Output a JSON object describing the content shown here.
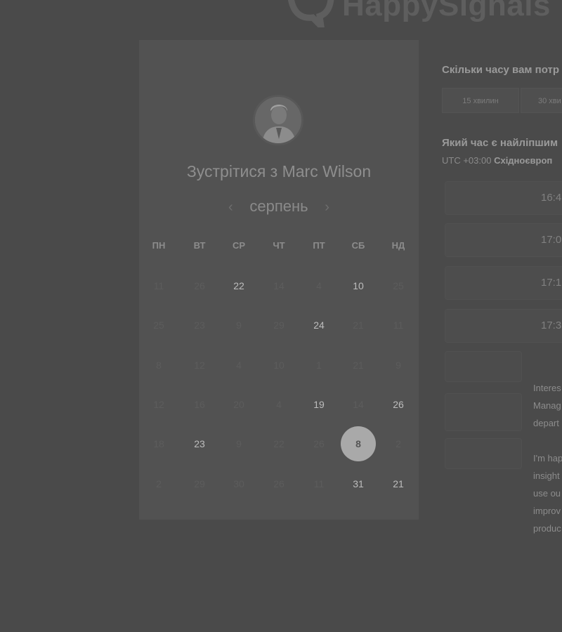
{
  "brand": {
    "name": "HappySignals"
  },
  "scheduler": {
    "meet_title": "Зустрітися з Marc Wilson",
    "month": "серпень",
    "prev_arrow": "‹",
    "next_arrow": "›",
    "weekdays": [
      "ПН",
      "ВТ",
      "СР",
      "ЧТ",
      "ПТ",
      "СБ",
      "НД"
    ],
    "weeks": [
      [
        {
          "d": "11",
          "a": false
        },
        {
          "d": "26",
          "a": false
        },
        {
          "d": "22",
          "a": true
        },
        {
          "d": "14",
          "a": false
        },
        {
          "d": "4",
          "a": false
        },
        {
          "d": "10",
          "a": true
        },
        {
          "d": "25",
          "a": false
        }
      ],
      [
        {
          "d": "25",
          "a": false
        },
        {
          "d": "23",
          "a": false
        },
        {
          "d": "9",
          "a": false
        },
        {
          "d": "29",
          "a": false
        },
        {
          "d": "24",
          "a": true
        },
        {
          "d": "21",
          "a": false
        },
        {
          "d": "11",
          "a": false
        }
      ],
      [
        {
          "d": "8",
          "a": false
        },
        {
          "d": "12",
          "a": false
        },
        {
          "d": "4",
          "a": false
        },
        {
          "d": "10",
          "a": false
        },
        {
          "d": "1",
          "a": false
        },
        {
          "d": "21",
          "a": false
        },
        {
          "d": "9",
          "a": false
        }
      ],
      [
        {
          "d": "12",
          "a": false
        },
        {
          "d": "16",
          "a": false
        },
        {
          "d": "20",
          "a": false
        },
        {
          "d": "4",
          "a": false
        },
        {
          "d": "19",
          "a": true
        },
        {
          "d": "14",
          "a": false
        },
        {
          "d": "26",
          "a": true
        }
      ],
      [
        {
          "d": "18",
          "a": false
        },
        {
          "d": "23",
          "a": true
        },
        {
          "d": "9",
          "a": false
        },
        {
          "d": "22",
          "a": false
        },
        {
          "d": "26",
          "a": false
        },
        {
          "d": "8",
          "a": true,
          "sel": true
        },
        {
          "d": "2",
          "a": false
        }
      ],
      [
        {
          "d": "2",
          "a": false
        },
        {
          "d": "29",
          "a": false
        },
        {
          "d": "30",
          "a": false
        },
        {
          "d": "26",
          "a": false
        },
        {
          "d": "11",
          "a": false
        },
        {
          "d": "31",
          "a": true
        },
        {
          "d": "21",
          "a": true
        }
      ]
    ]
  },
  "duration": {
    "question": "Скільки часу вам потр",
    "options": [
      "15 хвилин",
      "30 хви"
    ]
  },
  "times": {
    "question": "Який час є найліпшим",
    "tz_offset": "UTC +03:00",
    "tz_name": "Східноєвроп",
    "slots": [
      "16:4",
      "17:0",
      "17:1",
      "17:3"
    ]
  },
  "description": {
    "p1": [
      "Interes",
      "Manag",
      "depart"
    ],
    "p2": [
      "I'm hap",
      "insight",
      "use ou",
      "improv",
      "produc"
    ]
  }
}
